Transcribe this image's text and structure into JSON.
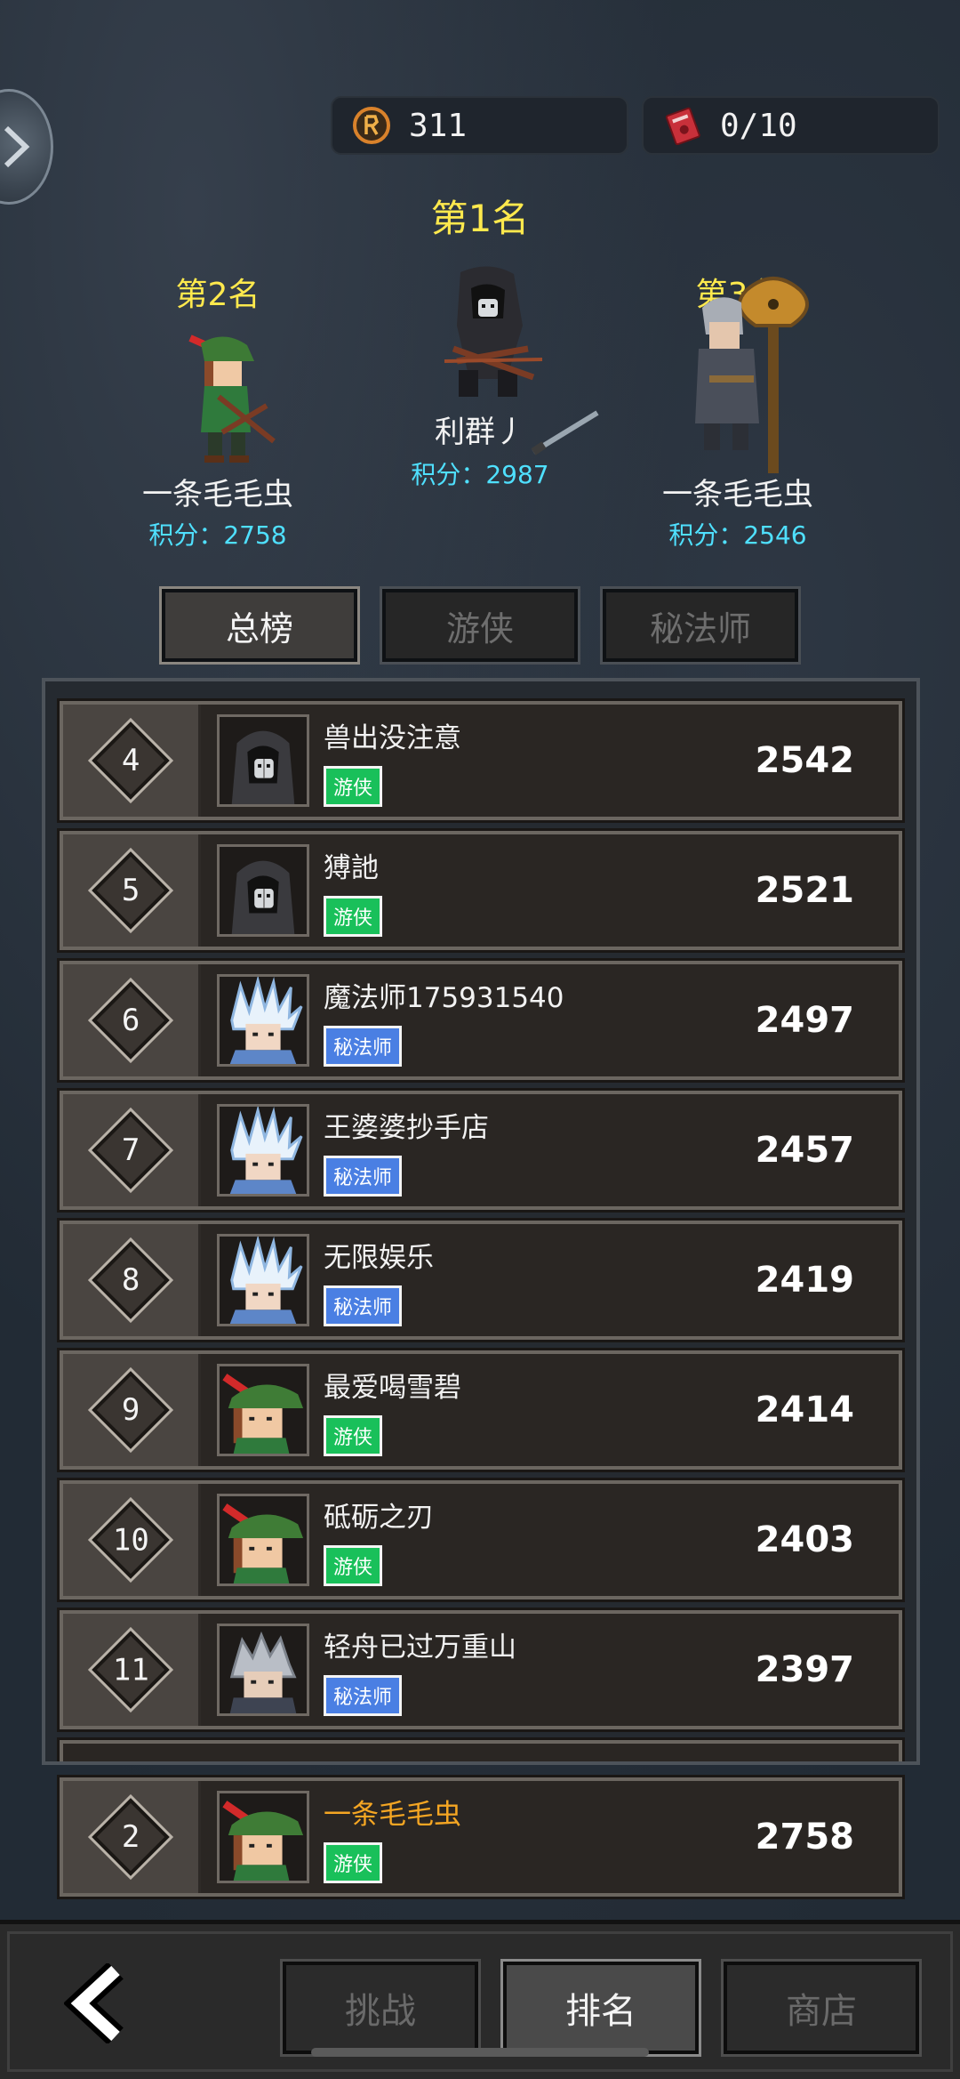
{
  "resources": {
    "gold": "311",
    "tickets": "0/10"
  },
  "podium": {
    "first": {
      "title": "第1名",
      "name": "利群丿",
      "score": "积分：2987"
    },
    "second": {
      "title": "第2名",
      "name": "一条毛毛虫",
      "score": "积分：2758"
    },
    "third": {
      "title": "第3名",
      "name": "一条毛毛虫",
      "score": "积分：2546"
    }
  },
  "tabs": [
    {
      "label": "总榜"
    },
    {
      "label": "游侠"
    },
    {
      "label": "秘法师"
    }
  ],
  "rows": [
    {
      "rank": "4",
      "name": "兽出没注意",
      "badge": "游侠",
      "score": "2542",
      "avatar": "hooded"
    },
    {
      "rank": "5",
      "name": "猼訑",
      "badge": "游侠",
      "score": "2521",
      "avatar": "hooded"
    },
    {
      "rank": "6",
      "name": "魔法师175931540",
      "badge": "秘法师",
      "score": "2497",
      "avatar": "ice-mage"
    },
    {
      "rank": "7",
      "name": "王婆婆抄手店",
      "badge": "秘法师",
      "score": "2457",
      "avatar": "ice-mage"
    },
    {
      "rank": "8",
      "name": "无限娱乐",
      "badge": "秘法师",
      "score": "2419",
      "avatar": "ice-mage"
    },
    {
      "rank": "9",
      "name": "最爱喝雪碧",
      "badge": "游侠",
      "score": "2414",
      "avatar": "green-hat"
    },
    {
      "rank": "10",
      "name": "砥砺之刃",
      "badge": "游侠",
      "score": "2403",
      "avatar": "green-hat"
    },
    {
      "rank": "11",
      "name": "轻舟已过万重山",
      "badge": "秘法师",
      "score": "2397",
      "avatar": "grey-mage"
    }
  ],
  "self": {
    "rank": "2",
    "name": "一条毛毛虫",
    "badge": "游侠",
    "score": "2758",
    "avatar": "green-hat"
  },
  "nav": {
    "challenge": "挑战",
    "rank": "排名",
    "shop": "商店"
  },
  "colors": {
    "ranger_badge": "#19c05a",
    "mage_badge": "#4a7fe3",
    "podium_title": "#ffe94d",
    "podium_score": "#4fe0ff",
    "self_name": "#f5a623"
  }
}
